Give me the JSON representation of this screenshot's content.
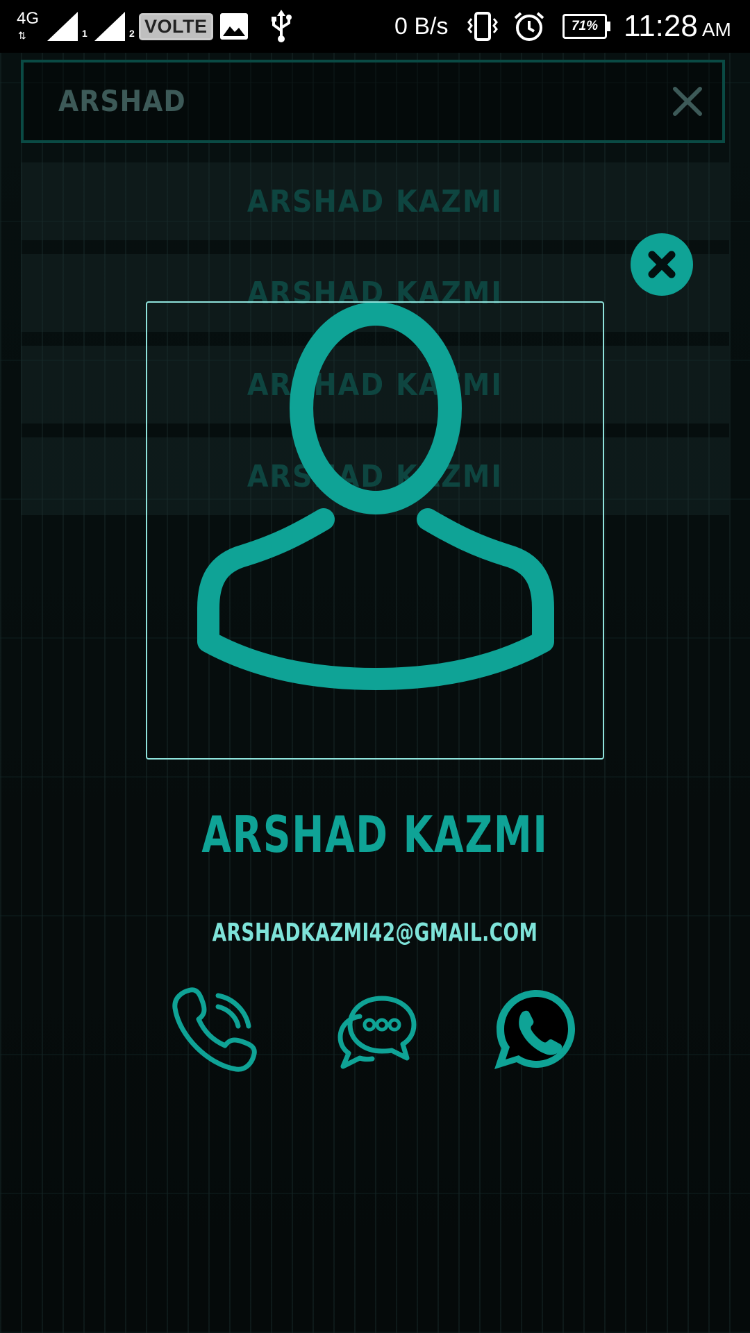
{
  "status_bar": {
    "network_type": "4G",
    "sim1_label": "1",
    "sim2_label": "2",
    "volte_label": "VOLTE",
    "data_speed": "0 B/s",
    "battery_percent": "71%",
    "time": "11:28",
    "ampm": "AM",
    "icons": [
      "signal-icon",
      "gallery-icon",
      "usb-icon",
      "vibrate-icon",
      "alarm-icon",
      "battery-icon"
    ]
  },
  "search": {
    "query": "ARSHAD",
    "clear_icon": "close-icon"
  },
  "results": [
    {
      "name": "ARSHAD KAZMI"
    },
    {
      "name": "ARSHAD KAZMI"
    },
    {
      "name": "ARSHAD KAZMI"
    },
    {
      "name": "ARSHAD KAZMI"
    }
  ],
  "dialog": {
    "close_icon": "close-circle-icon",
    "avatar_icon": "person-avatar-icon",
    "contact_name": "ARSHAD KAZMI",
    "contact_email": "ARSHADKAZMI42@GMAIL.COM",
    "actions": [
      {
        "name": "call",
        "icon": "phone-call-icon"
      },
      {
        "name": "message",
        "icon": "chat-bubbles-icon"
      },
      {
        "name": "whatsapp",
        "icon": "whatsapp-icon"
      }
    ]
  },
  "colors": {
    "accent": "#0fa396",
    "accent_light": "#7ee3d9",
    "frame_border": "#8fe3dc",
    "background": "#000000"
  }
}
